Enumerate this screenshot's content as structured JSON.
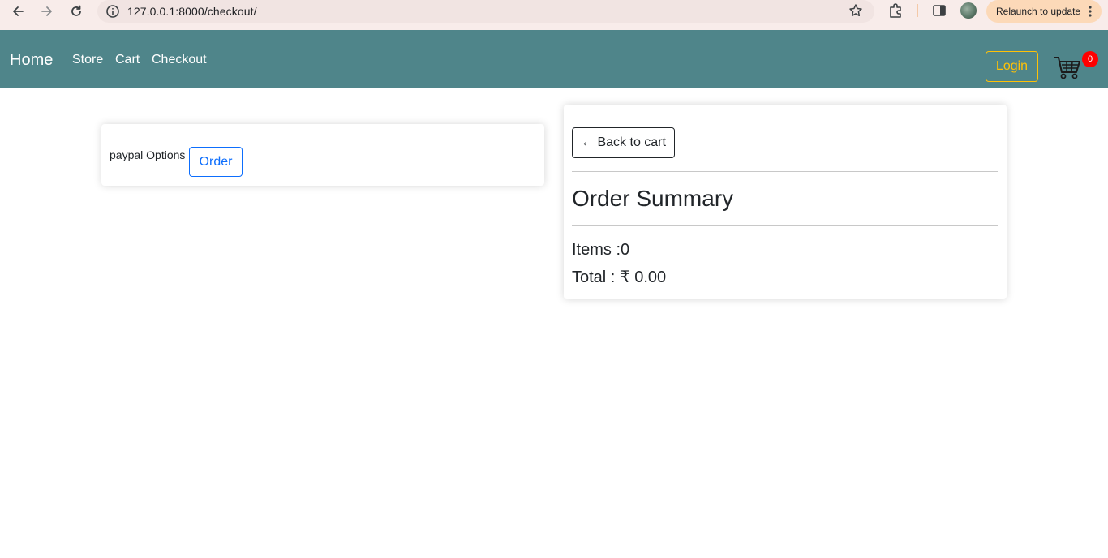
{
  "browser": {
    "url": "127.0.0.1:8000/checkout/",
    "relaunch_label": "Relaunch to update"
  },
  "navbar": {
    "brand": "Home",
    "links": [
      "Store",
      "Cart",
      "Checkout"
    ],
    "login_label": "Login",
    "cart_count": "0"
  },
  "payment": {
    "label": "paypal Options",
    "order_label": "Order"
  },
  "summary": {
    "back_label": "← Back to cart",
    "title": "Order Summary",
    "items_text": "Items :0",
    "total_text": "Total : ₹ 0.00"
  },
  "colors": {
    "navbar": "#4f858a",
    "login_accent": "#ffc107",
    "order_accent": "#0d6efd",
    "badge": "#ff0000"
  },
  "icons": [
    "back-arrow-icon",
    "forward-arrow-icon",
    "reload-icon",
    "site-info-icon",
    "bookmark-star-icon",
    "extensions-icon",
    "side-panel-icon",
    "more-vert-icon",
    "cart-icon"
  ]
}
